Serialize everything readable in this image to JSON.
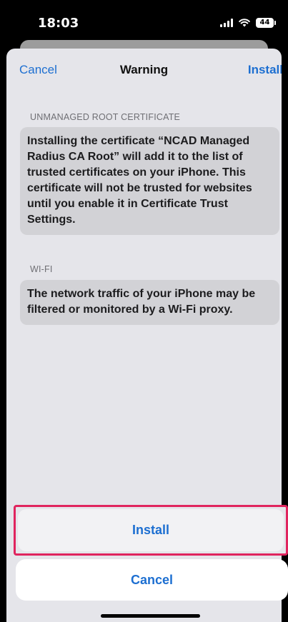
{
  "status_bar": {
    "time": "18:03",
    "battery": "44",
    "icons": [
      "signal-icon",
      "wifi-icon",
      "battery-icon"
    ]
  },
  "nav": {
    "cancel_label": "Cancel",
    "title": "Warning",
    "install_label": "Install"
  },
  "sections": [
    {
      "header": "UNMANAGED ROOT CERTIFICATE",
      "body": "Installing the certificate “NCAD Managed Radius CA Root” will add it to the list of trusted certificates on your iPhone. This certificate will not be trusted for websites until you enable it in Certificate Trust Settings."
    },
    {
      "header": "WI-FI",
      "body": "The network traffic of your iPhone may be filtered or monitored by a Wi-Fi proxy."
    }
  ],
  "actions": {
    "install_label": "Install",
    "cancel_label": "Cancel"
  },
  "colors": {
    "accent": "#1d6fd1",
    "highlight_border": "#e0245e",
    "sheet_background": "#e5e5ea",
    "card_background": "#d2d2d6"
  }
}
